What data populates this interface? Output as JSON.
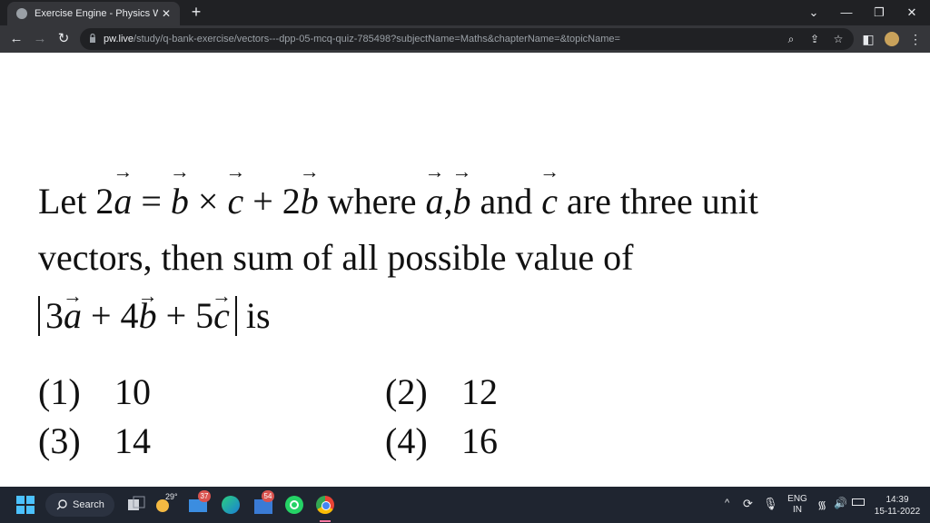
{
  "browser": {
    "tab_title": "Exercise Engine - Physics Wallah",
    "tab_close": "✕",
    "new_tab": "+",
    "url_host": "pw.live",
    "url_path": "/study/q-bank-exercise/vectors---dpp-05-mcq-quiz-785498?subjectName=Maths&chapterName=&topicName="
  },
  "question": {
    "line1_prefix": "Let ",
    "line1_coef2a": "2",
    "line1_eq": " = ",
    "line1_cross": " × ",
    "line1_plus": " + 2",
    "line1_where": "  where ",
    "line1_comma": ",",
    "line1_and": " and ",
    "line1_rest": "  are  three  unit",
    "line2": "vectors,  then  sum  of  all  possible  value  of",
    "line3_c3": "3",
    "line3_p4": " + 4",
    "line3_p5": " + 5",
    "line3_is": " is",
    "var_a": "a",
    "var_b": "b",
    "var_c": "c"
  },
  "options": [
    {
      "label": "(1)",
      "value": "10"
    },
    {
      "label": "(2)",
      "value": "12"
    },
    {
      "label": "(3)",
      "value": "14"
    },
    {
      "label": "(4)",
      "value": "16"
    }
  ],
  "taskbar": {
    "search_label": "Search",
    "weather_temp": "29°",
    "mail_badge": "37",
    "store_badge": "54",
    "lang_line1": "ENG",
    "lang_line2": "IN",
    "time": "14:39",
    "date": "15-11-2022"
  },
  "colors": {
    "browser_dark": "#202124",
    "toolbar": "#35363a",
    "taskbar": "#1f2530",
    "text": "#111111"
  }
}
